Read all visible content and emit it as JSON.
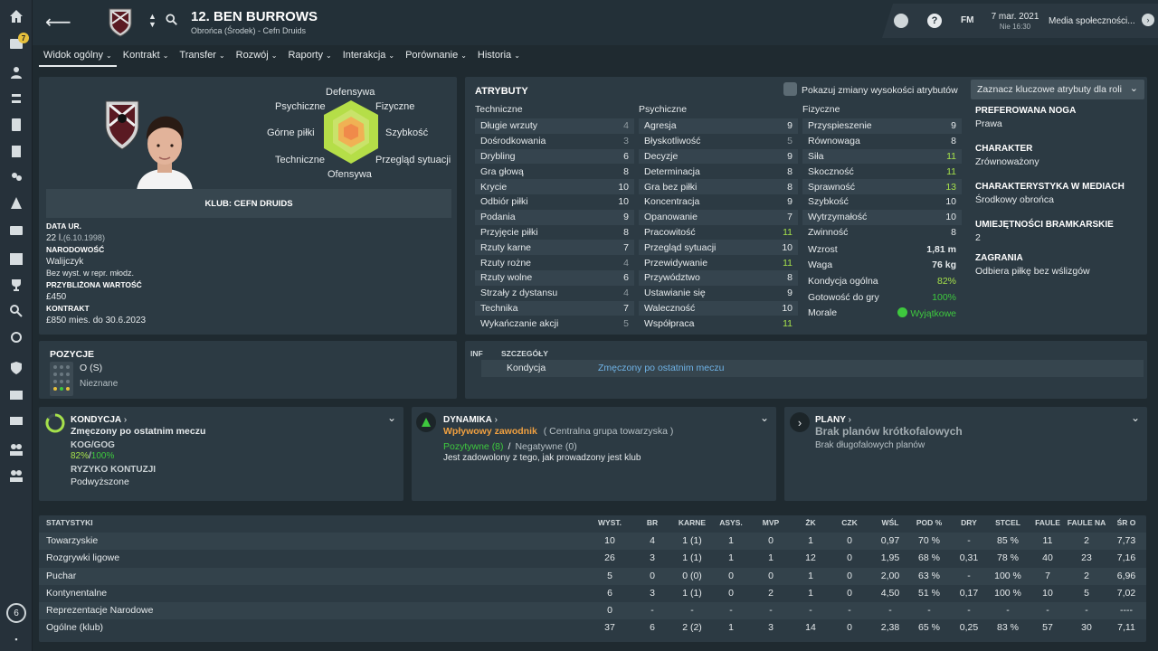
{
  "sidebar": {
    "notification_count": "7",
    "bottom_count": "6"
  },
  "header": {
    "player_title": "12. BEN BURROWS",
    "player_subtitle": "Obrońca (Środek) - Cefn Druids",
    "date": "7 mar. 2021",
    "time": "Nie 16:30",
    "media_label": "Media społeczności...",
    "fm_label": "FM",
    "help_label": "?"
  },
  "tabs": [
    {
      "label": "Widok ogólny"
    },
    {
      "label": "Kontrakt"
    },
    {
      "label": "Transfer"
    },
    {
      "label": "Rozwój"
    },
    {
      "label": "Raporty"
    },
    {
      "label": "Interakcja"
    },
    {
      "label": "Porównanie"
    },
    {
      "label": "Historia"
    }
  ],
  "profile": {
    "club_label": "KLUB: CEFN DRUIDS",
    "radar": {
      "top": "Defensywa",
      "top_left": "Psychiczne",
      "top_right": "Fizyczne",
      "left": "Górne piłki",
      "right": "Szybkość",
      "bottom_left": "Techniczne",
      "bottom_right": "Przegląd sytuacji",
      "bottom": "Ofensywa"
    },
    "dob_label": "DATA UR.",
    "age": "22 l.",
    "dob": "(6.10.1998)",
    "nationality_label": "NARODOWOŚĆ",
    "nationality": "Walijczyk",
    "intl": "Bez wyst. w repr. młodz.",
    "value_label": "PRZYBLIŻONA WARTOŚĆ",
    "value": "£450",
    "contract_label": "KONTRAKT",
    "contract": "£850 mies. do 30.6.2023"
  },
  "attributes": {
    "title": "ATRYBUTY",
    "toggle_label": "Pokazuj zmiany wysokości atrybutów",
    "dropdown_label": "Zaznacz kluczowe atrybuty dla roli",
    "technical_header": "Techniczne",
    "mental_header": "Psychiczne",
    "physical_header": "Fizyczne",
    "technical": [
      {
        "name": "Długie wrzuty",
        "value": "4"
      },
      {
        "name": "Dośrodkowania",
        "value": "3"
      },
      {
        "name": "Drybling",
        "value": "6"
      },
      {
        "name": "Gra głową",
        "value": "8"
      },
      {
        "name": "Krycie",
        "value": "10"
      },
      {
        "name": "Odbiór piłki",
        "value": "10"
      },
      {
        "name": "Podania",
        "value": "9"
      },
      {
        "name": "Przyjęcie piłki",
        "value": "8"
      },
      {
        "name": "Rzuty karne",
        "value": "7"
      },
      {
        "name": "Rzuty rożne",
        "value": "4"
      },
      {
        "name": "Rzuty wolne",
        "value": "6"
      },
      {
        "name": "Strzały z dystansu",
        "value": "4"
      },
      {
        "name": "Technika",
        "value": "7"
      },
      {
        "name": "Wykańczanie akcji",
        "value": "5"
      }
    ],
    "mental": [
      {
        "name": "Agresja",
        "value": "9"
      },
      {
        "name": "Błyskotliwość",
        "value": "5"
      },
      {
        "name": "Decyzje",
        "value": "9"
      },
      {
        "name": "Determinacja",
        "value": "8"
      },
      {
        "name": "Gra bez piłki",
        "value": "8"
      },
      {
        "name": "Koncentracja",
        "value": "9"
      },
      {
        "name": "Opanowanie",
        "value": "7"
      },
      {
        "name": "Pracowitość",
        "value": "11"
      },
      {
        "name": "Przegląd sytuacji",
        "value": "10"
      },
      {
        "name": "Przewidywanie",
        "value": "11"
      },
      {
        "name": "Przywództwo",
        "value": "8"
      },
      {
        "name": "Ustawianie się",
        "value": "9"
      },
      {
        "name": "Waleczność",
        "value": "10"
      },
      {
        "name": "Współpraca",
        "value": "11"
      }
    ],
    "physical": [
      {
        "name": "Przyspieszenie",
        "value": "9"
      },
      {
        "name": "Równowaga",
        "value": "8"
      },
      {
        "name": "Siła",
        "value": "11"
      },
      {
        "name": "Skoczność",
        "value": "11"
      },
      {
        "name": "Sprawność",
        "value": "13"
      },
      {
        "name": "Szybkość",
        "value": "10"
      },
      {
        "name": "Wytrzymałość",
        "value": "10"
      },
      {
        "name": "Zwinność",
        "value": "8"
      }
    ],
    "extra": [
      {
        "name": "Wzrost",
        "value": "1,81 m"
      },
      {
        "name": "Waga",
        "value": "76 kg"
      },
      {
        "name": "Kondycja ogólna",
        "value": "82%"
      },
      {
        "name": "Gotowość do gry",
        "value": "100%"
      },
      {
        "name": "Morale",
        "value": "Wyjątkowe"
      }
    ]
  },
  "info": {
    "foot_label": "PREFEROWANA NOGA",
    "foot": "Prawa",
    "character_label": "CHARAKTER",
    "character": "Zrównoważony",
    "media_label": "CHARAKTERYSTYKA W MEDIACH",
    "media": "Środkowy obrońca",
    "gk_label": "UMIEJĘTNOŚCI BRAMKARSKIE",
    "gk": "2",
    "plays_label": "ZAGRANIA",
    "plays": "Odbiera piłkę bez wślizgów"
  },
  "positions": {
    "title": "POZYCJE",
    "pos": "O (S)",
    "secondary": "Nieznane"
  },
  "details": {
    "inf_label": "INF",
    "header": "SZCZEGÓŁY",
    "row_label": "Kondycja",
    "row_value": "Zmęczony po ostatnim meczu"
  },
  "condition_card": {
    "title": "KONDYCJA",
    "status": "Zmęczony po ostatnim meczu",
    "kog_label": "KOG/GOG",
    "kog": "82%",
    "gog": "100%",
    "injury_label": "RYZYKO KONTUZJI",
    "injury": "Podwyższone"
  },
  "dynamics_card": {
    "title": "DYNAMIKA",
    "role": "Wpływowy zawodnik",
    "group": "( Centralna grupa towarzyska )",
    "positive": "Pozytywne (8)",
    "negative": "Negatywne (0)",
    "note": "Jest zadowolony z tego, jak prowadzony jest klub"
  },
  "plans_card": {
    "title": "PLANY",
    "short": "Brak planów krótkofalowych",
    "long": "Brak długofalowych planów"
  },
  "stats": {
    "headers": [
      "STATYSTYKI",
      "WYST.",
      "BR",
      "KARNE",
      "ASYS.",
      "MVP",
      "ŻK",
      "CZK",
      "WŚL",
      "POD %",
      "DRY",
      "STCEL",
      "FAULE",
      "FAULE NA",
      "ŚR O"
    ],
    "rows": [
      [
        "Towarzyskie",
        "10",
        "4",
        "1 (1)",
        "1",
        "0",
        "1",
        "0",
        "0,97",
        "70 %",
        "-",
        "85 %",
        "11",
        "2",
        "7,73"
      ],
      [
        "Rozgrywki ligowe",
        "26",
        "3",
        "1 (1)",
        "1",
        "1",
        "12",
        "0",
        "1,95",
        "68 %",
        "0,31",
        "78 %",
        "40",
        "23",
        "7,16"
      ],
      [
        "Puchar",
        "5",
        "0",
        "0 (0)",
        "0",
        "0",
        "1",
        "0",
        "2,00",
        "63 %",
        "-",
        "100 %",
        "7",
        "2",
        "6,96"
      ],
      [
        "Kontynentalne",
        "6",
        "3",
        "1 (1)",
        "0",
        "2",
        "1",
        "0",
        "4,50",
        "51 %",
        "0,17",
        "100 %",
        "10",
        "5",
        "7,02"
      ],
      [
        "Reprezentacje Narodowe",
        "0",
        "-",
        "-",
        "-",
        "-",
        "-",
        "-",
        "-",
        "-",
        "-",
        "-",
        "-",
        "-",
        "----"
      ],
      [
        "Ogólne (klub)",
        "37",
        "6",
        "2 (2)",
        "1",
        "3",
        "14",
        "0",
        "2,38",
        "65 %",
        "0,25",
        "83 %",
        "57",
        "30",
        "7,11"
      ]
    ]
  },
  "colors": {
    "bg": "#1f2a30",
    "panel": "#2c3a43",
    "accent_green": "#3ec83e",
    "accent_lime": "#a5e04b",
    "accent_orange": "#f0a040",
    "link_blue": "#6fb3e6"
  }
}
